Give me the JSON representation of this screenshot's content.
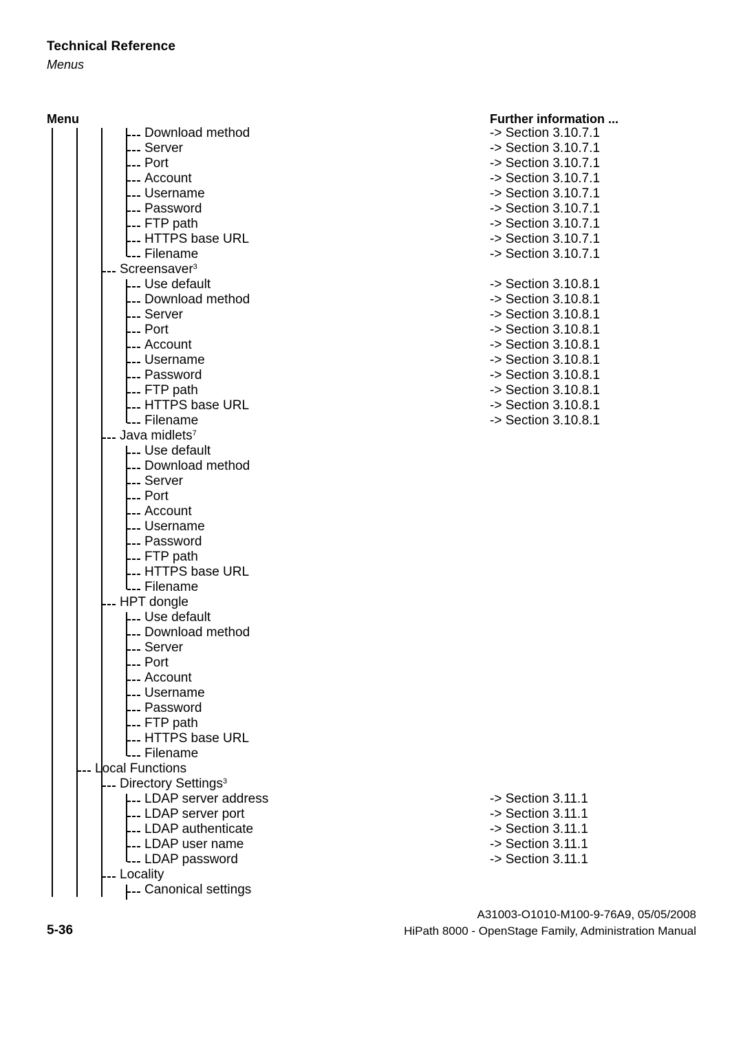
{
  "header": {
    "title": "Technical Reference",
    "subtitle": "Menus"
  },
  "columns": {
    "menu": "Menu",
    "further": "Further information ..."
  },
  "footer": {
    "page_number": "5-36",
    "doc_id": "A31003-O1010-M100-9-76A9, 05/05/2008",
    "manual": "HiPath 8000 - OpenStage Family, Administration Manual"
  },
  "tree": [
    {
      "level": 5,
      "label": "Download method",
      "ref": "-> Section 3.10.7.1",
      "last": false
    },
    {
      "level": 5,
      "label": "Server",
      "ref": "-> Section 3.10.7.1",
      "last": false
    },
    {
      "level": 5,
      "label": "Port",
      "ref": "-> Section 3.10.7.1",
      "last": false
    },
    {
      "level": 5,
      "label": "Account",
      "ref": "-> Section 3.10.7.1",
      "last": false
    },
    {
      "level": 5,
      "label": "Username",
      "ref": "-> Section 3.10.7.1",
      "last": false
    },
    {
      "level": 5,
      "label": "Password",
      "ref": "-> Section 3.10.7.1",
      "last": false
    },
    {
      "level": 5,
      "label": "FTP path",
      "ref": "-> Section 3.10.7.1",
      "last": false
    },
    {
      "level": 5,
      "label": "HTTPS base URL",
      "ref": "-> Section 3.10.7.1",
      "last": false
    },
    {
      "level": 5,
      "label": "Filename",
      "ref": "-> Section 3.10.7.1",
      "last": true
    },
    {
      "level": 4,
      "label": "Screensaver",
      "sup": "3",
      "ref": "",
      "last": false
    },
    {
      "level": 5,
      "label": "Use default",
      "ref": "-> Section 3.10.8.1",
      "last": false
    },
    {
      "level": 5,
      "label": "Download method",
      "ref": "-> Section 3.10.8.1",
      "last": false
    },
    {
      "level": 5,
      "label": "Server",
      "ref": "-> Section 3.10.8.1",
      "last": false
    },
    {
      "level": 5,
      "label": "Port",
      "ref": "-> Section 3.10.8.1",
      "last": false
    },
    {
      "level": 5,
      "label": "Account",
      "ref": "-> Section 3.10.8.1",
      "last": false
    },
    {
      "level": 5,
      "label": "Username",
      "ref": "-> Section 3.10.8.1",
      "last": false
    },
    {
      "level": 5,
      "label": "Password",
      "ref": "-> Section 3.10.8.1",
      "last": false
    },
    {
      "level": 5,
      "label": "FTP path",
      "ref": "-> Section 3.10.8.1",
      "last": false
    },
    {
      "level": 5,
      "label": "HTTPS base URL",
      "ref": "-> Section 3.10.8.1",
      "last": false
    },
    {
      "level": 5,
      "label": "Filename",
      "ref": "-> Section 3.10.8.1",
      "last": true
    },
    {
      "level": 4,
      "label": "Java midlets",
      "sup": "7",
      "ref": "",
      "last": false
    },
    {
      "level": 5,
      "label": "Use default",
      "ref": "",
      "last": false
    },
    {
      "level": 5,
      "label": "Download method",
      "ref": "",
      "last": false
    },
    {
      "level": 5,
      "label": "Server",
      "ref": "",
      "last": false
    },
    {
      "level": 5,
      "label": "Port",
      "ref": "",
      "last": false
    },
    {
      "level": 5,
      "label": "Account",
      "ref": "",
      "last": false
    },
    {
      "level": 5,
      "label": "Username",
      "ref": "",
      "last": false
    },
    {
      "level": 5,
      "label": "Password",
      "ref": "",
      "last": false
    },
    {
      "level": 5,
      "label": "FTP path",
      "ref": "",
      "last": false
    },
    {
      "level": 5,
      "label": "HTTPS base URL",
      "ref": "",
      "last": false
    },
    {
      "level": 5,
      "label": "Filename",
      "ref": "",
      "last": true
    },
    {
      "level": 4,
      "label": "HPT dongle",
      "ref": "",
      "last": true
    },
    {
      "level": 5,
      "label": "Use default",
      "ref": "",
      "last": false
    },
    {
      "level": 5,
      "label": "Download method",
      "ref": "",
      "last": false
    },
    {
      "level": 5,
      "label": "Server",
      "ref": "",
      "last": false
    },
    {
      "level": 5,
      "label": "Port",
      "ref": "",
      "last": false
    },
    {
      "level": 5,
      "label": "Account",
      "ref": "",
      "last": false
    },
    {
      "level": 5,
      "label": "Username",
      "ref": "",
      "last": false
    },
    {
      "level": 5,
      "label": "Password",
      "ref": "",
      "last": false
    },
    {
      "level": 5,
      "label": "FTP path",
      "ref": "",
      "last": false
    },
    {
      "level": 5,
      "label": "HTTPS base URL",
      "ref": "",
      "last": false
    },
    {
      "level": 5,
      "label": "Filename",
      "ref": "",
      "last": true
    },
    {
      "level": 3,
      "label": "Local Functions",
      "ref": "",
      "last": false
    },
    {
      "level": 4,
      "label": "Directory Settings",
      "sup": "3",
      "ref": "",
      "last": false
    },
    {
      "level": 5,
      "label": "LDAP server address",
      "ref": "-> Section 3.11.1",
      "last": false
    },
    {
      "level": 5,
      "label": "LDAP server port",
      "ref": "-> Section 3.11.1",
      "last": false
    },
    {
      "level": 5,
      "label": "LDAP authenticate",
      "ref": "-> Section 3.11.1",
      "last": false
    },
    {
      "level": 5,
      "label": "LDAP user name",
      "ref": "-> Section 3.11.1",
      "last": false
    },
    {
      "level": 5,
      "label": "LDAP password",
      "ref": "-> Section 3.11.1",
      "last": true
    },
    {
      "level": 4,
      "label": "Locality",
      "ref": "",
      "last": false
    },
    {
      "level": 5,
      "label": "Canonical settings",
      "ref": "",
      "last": false
    }
  ]
}
